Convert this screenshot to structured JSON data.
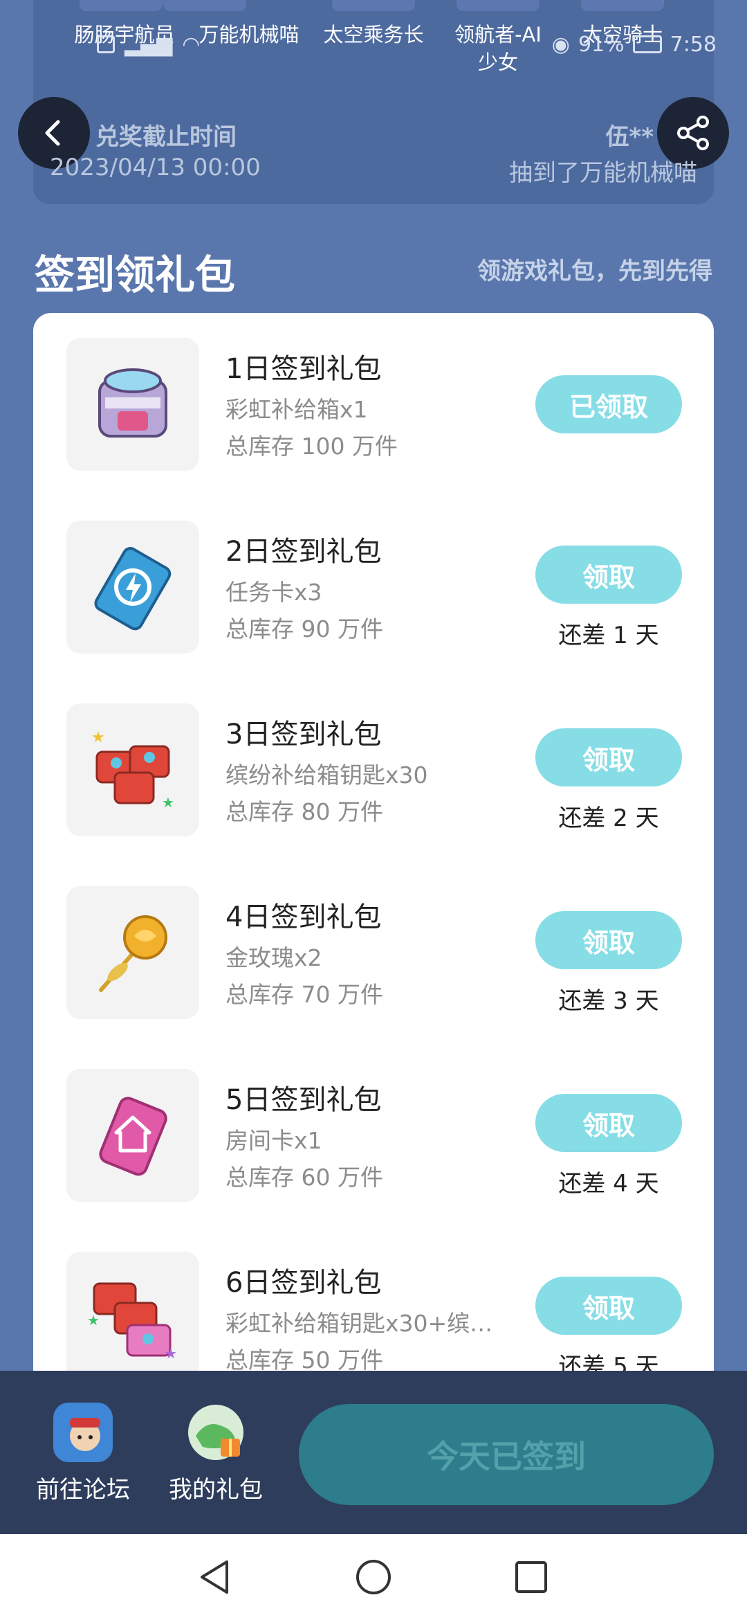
{
  "status_bar": {
    "battery": "91%",
    "time": "7:58"
  },
  "prize_names": [
    "肠肠宇航员",
    "万能机械喵",
    "太空乘务长",
    "领航者-AI\n少女",
    "太空骑士"
  ],
  "deadline": {
    "label": "兑奖截止时间",
    "value": "2023/04/13 00:00"
  },
  "winner": {
    "name": "伍**",
    "prize": "抽到了万能机械喵"
  },
  "section": {
    "title": "签到领礼包",
    "subtitle": "领游戏礼包，先到先得"
  },
  "gifts": [
    {
      "title": "1日签到礼包",
      "item": "彩虹补给箱x1",
      "stock": "总库存 100 万件",
      "button": "已领取",
      "remaining": "",
      "icon": "rainbow-crate-icon"
    },
    {
      "title": "2日签到礼包",
      "item": "任务卡x3",
      "stock": "总库存 90 万件",
      "button": "领取",
      "remaining": "还差 1 天",
      "icon": "mission-card-icon"
    },
    {
      "title": "3日签到礼包",
      "item": "缤纷补给箱钥匙x30",
      "stock": "总库存 80 万件",
      "button": "领取",
      "remaining": "还差 2 天",
      "icon": "supply-keys-icon"
    },
    {
      "title": "4日签到礼包",
      "item": "金玫瑰x2",
      "stock": "总库存 70 万件",
      "button": "领取",
      "remaining": "还差 3 天",
      "icon": "golden-rose-icon"
    },
    {
      "title": "5日签到礼包",
      "item": "房间卡x1",
      "stock": "总库存 60 万件",
      "button": "领取",
      "remaining": "还差 4 天",
      "icon": "room-card-icon"
    },
    {
      "title": "6日签到礼包",
      "item": "彩虹补给箱钥匙x30+缤…",
      "stock": "总库存 50 万件",
      "button": "领取",
      "remaining": "还差 5 天",
      "icon": "mixed-keys-icon"
    }
  ],
  "bottom": {
    "forum": "前往论坛",
    "my_gifts": "我的礼包",
    "checkin": "今天已签到"
  },
  "colors": {
    "accent": "#86dde6",
    "background": "#5a77ad",
    "checkin": "#2d7d8c"
  }
}
